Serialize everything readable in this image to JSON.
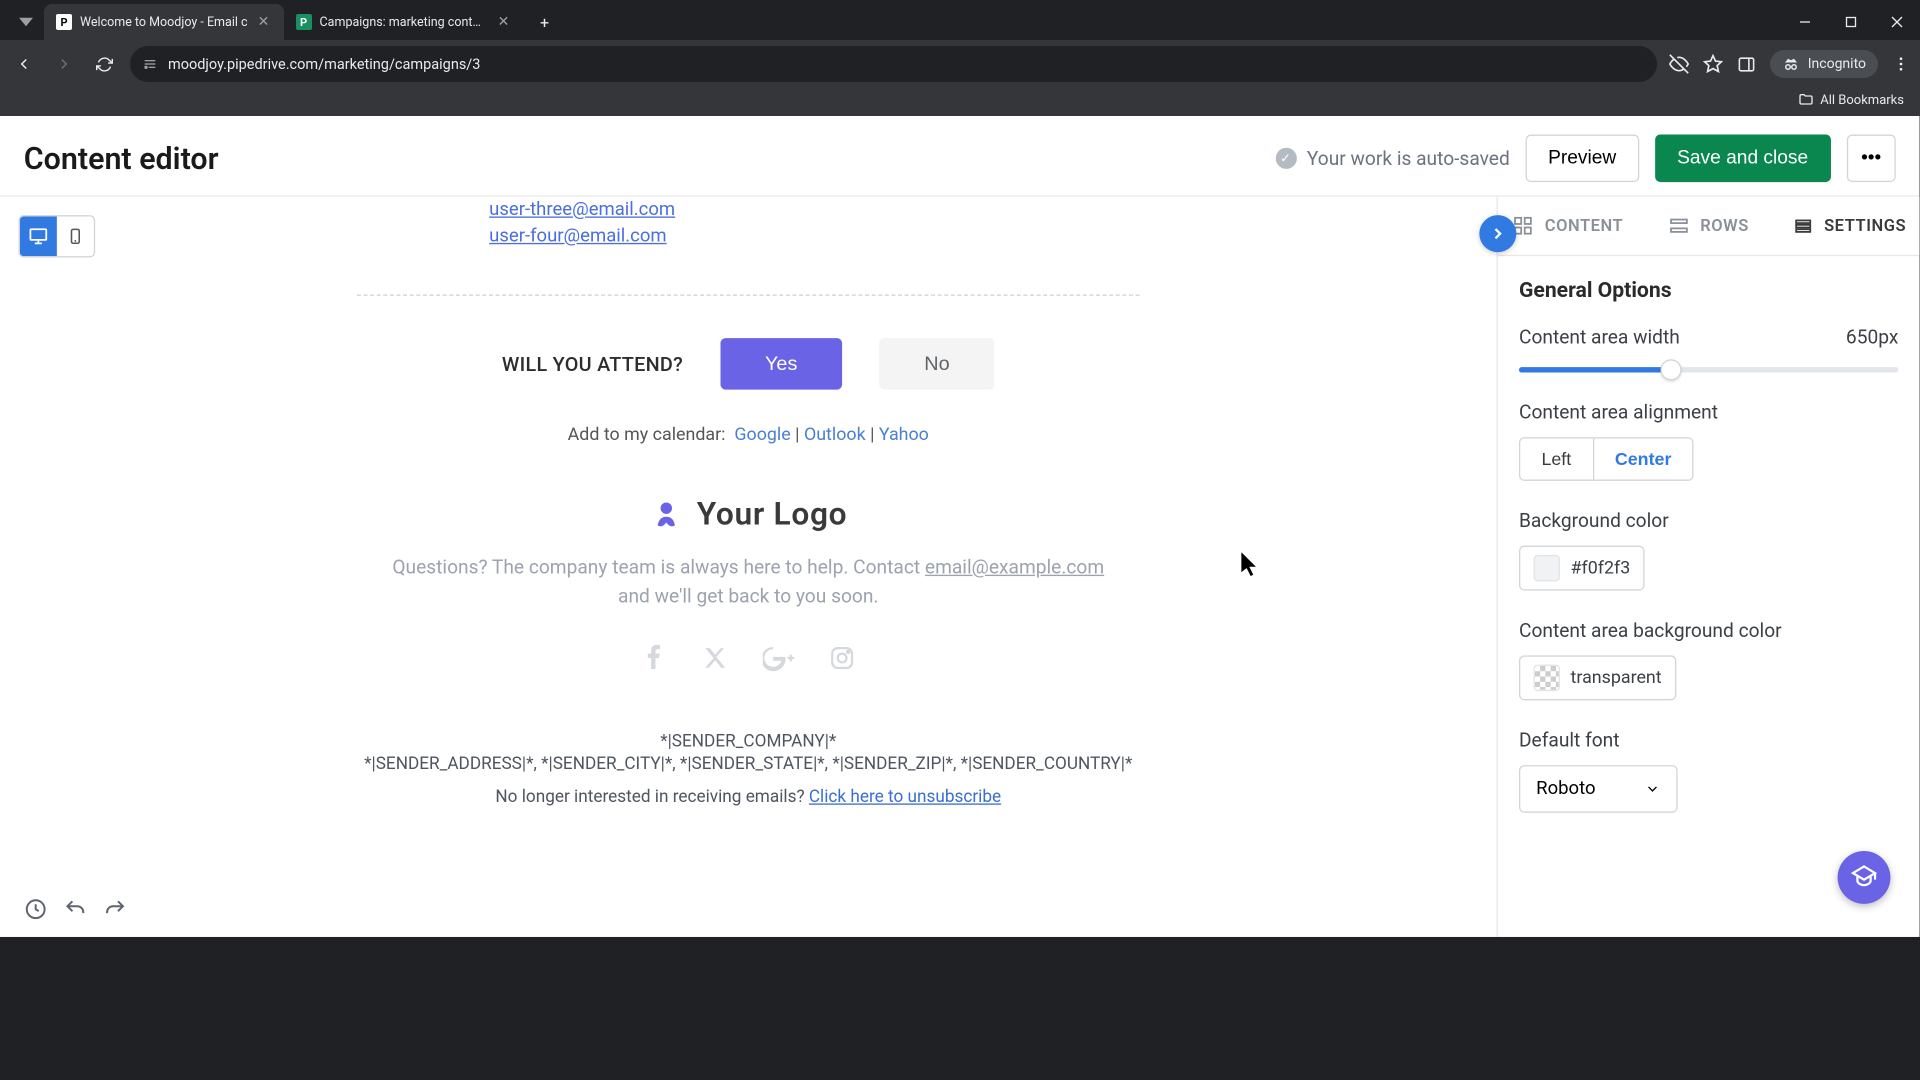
{
  "browser": {
    "tabs": [
      {
        "title": "Welcome to Moodjoy - Email c",
        "favicon": "P"
      },
      {
        "title": "Campaigns: marketing contacts",
        "favicon": "P"
      }
    ],
    "url": "moodjoy.pipedrive.com/marketing/campaigns/3",
    "incognito": "Incognito",
    "all_bookmarks": "All Bookmarks"
  },
  "topbar": {
    "title": "Content editor",
    "autosave": "Your work is auto-saved",
    "preview": "Preview",
    "save": "Save and close",
    "more": "•••"
  },
  "email": {
    "links": [
      "user-three@email.com",
      "user-four@email.com"
    ],
    "attend_question": "WILL YOU ATTEND?",
    "yes": "Yes",
    "no": "No",
    "calendar_label": "Add to my calendar:",
    "google": "Google",
    "outlook": "Outlook",
    "yahoo": "Yahoo",
    "logo_text": "Your Logo",
    "help_pre": "Questions? The company team is always here to help. Contact ",
    "help_email": "email@example.com",
    "help_post": " and we'll get back to you soon.",
    "legal_company": "*|SENDER_COMPANY|*",
    "legal_address": "*|SENDER_ADDRESS|*, *|SENDER_CITY|*, *|SENDER_STATE|*, *|SENDER_ZIP|*, *|SENDER_COUNTRY|*",
    "unsubscribe_pre": "No longer interested in receiving emails? ",
    "unsubscribe_link": "Click here to unsubscribe"
  },
  "panel": {
    "tabs": {
      "content": "CONTENT",
      "rows": "ROWS",
      "settings": "SETTINGS"
    },
    "section_title": "General Options",
    "content_width_label": "Content area width",
    "content_width_value": "650px",
    "alignment_label": "Content area alignment",
    "alignment_left": "Left",
    "alignment_center": "Center",
    "bg_label": "Background color",
    "bg_value": "#f0f2f3",
    "content_bg_label": "Content area background color",
    "content_bg_value": "transparent",
    "font_label": "Default font",
    "font_value": "Roboto"
  },
  "colors": {
    "accent": "#317ae2",
    "primary_btn": "#6a63e6"
  }
}
